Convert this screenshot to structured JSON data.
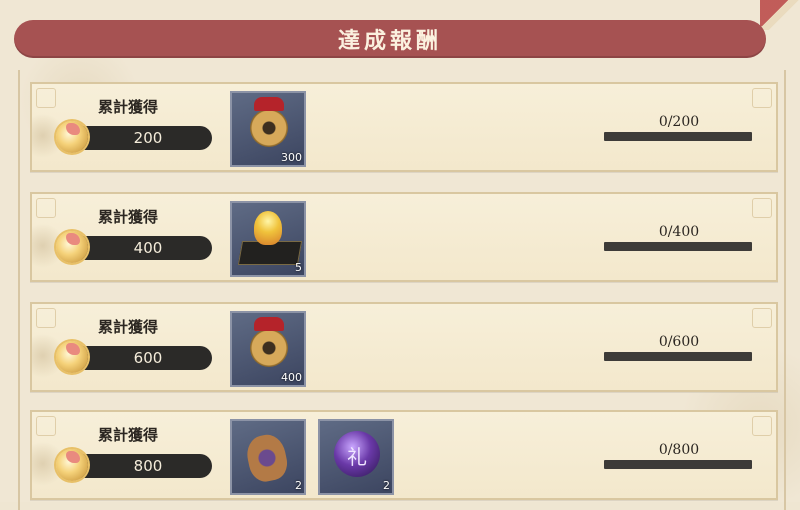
{
  "header": {
    "title": "達成報酬"
  },
  "rows": [
    {
      "label": "累計獲得",
      "amount": "200",
      "progress_text": "0/200",
      "progress": 0,
      "items": [
        {
          "icon": "coin-bundle-icon",
          "count": "300"
        }
      ]
    },
    {
      "label": "累計獲得",
      "amount": "400",
      "progress_text": "0/400",
      "progress": 0,
      "items": [
        {
          "icon": "gift-box-icon",
          "count": "5"
        }
      ]
    },
    {
      "label": "累計獲得",
      "amount": "600",
      "progress_text": "0/600",
      "progress": 0,
      "items": [
        {
          "icon": "coin-bundle-icon",
          "count": "400"
        }
      ]
    },
    {
      "label": "累計獲得",
      "amount": "800",
      "progress_text": "0/800",
      "progress": 0,
      "items": [
        {
          "icon": "charm-tag-icon",
          "count": "2"
        },
        {
          "icon": "purple-orb-icon",
          "count": "2",
          "glyph": "礼"
        }
      ]
    }
  ],
  "colors": {
    "header_bg": "#a65252",
    "row_bg": "#f3e8cc",
    "pill_bg": "#2b2a28",
    "item_bg": "#4a5470"
  }
}
